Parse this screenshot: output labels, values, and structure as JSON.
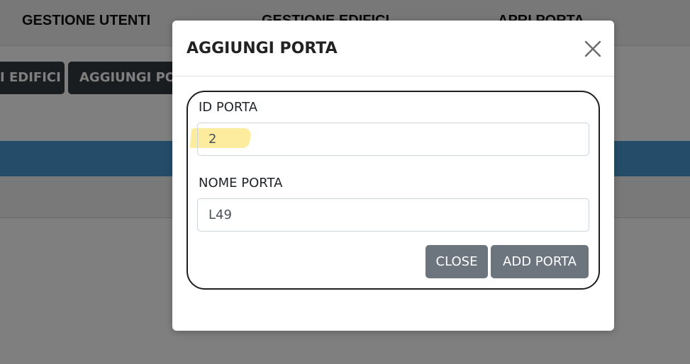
{
  "navbar": {
    "items": [
      "GESTIONE UTENTI",
      "GESTIONE EDIFICI",
      "APRI PORTA"
    ]
  },
  "toolbar": {
    "edifici_label": "I EDIFICI",
    "aggiungi_label": "AGGIUNGI PO"
  },
  "modal": {
    "title": "AGGIUNGI PORTA",
    "close_icon": "close-icon",
    "fields": {
      "id_label": "ID PORTA",
      "id_value": "2",
      "nome_label": "NOME PORTA",
      "nome_value": "L49"
    },
    "buttons": {
      "close_label": "CLOSE",
      "add_label": "ADD PORTA"
    }
  },
  "colors": {
    "accent_blue": "#4a9bd3",
    "dark_button": "#343a40",
    "grey_button": "#6c757d",
    "highlight": "#fde98c"
  }
}
